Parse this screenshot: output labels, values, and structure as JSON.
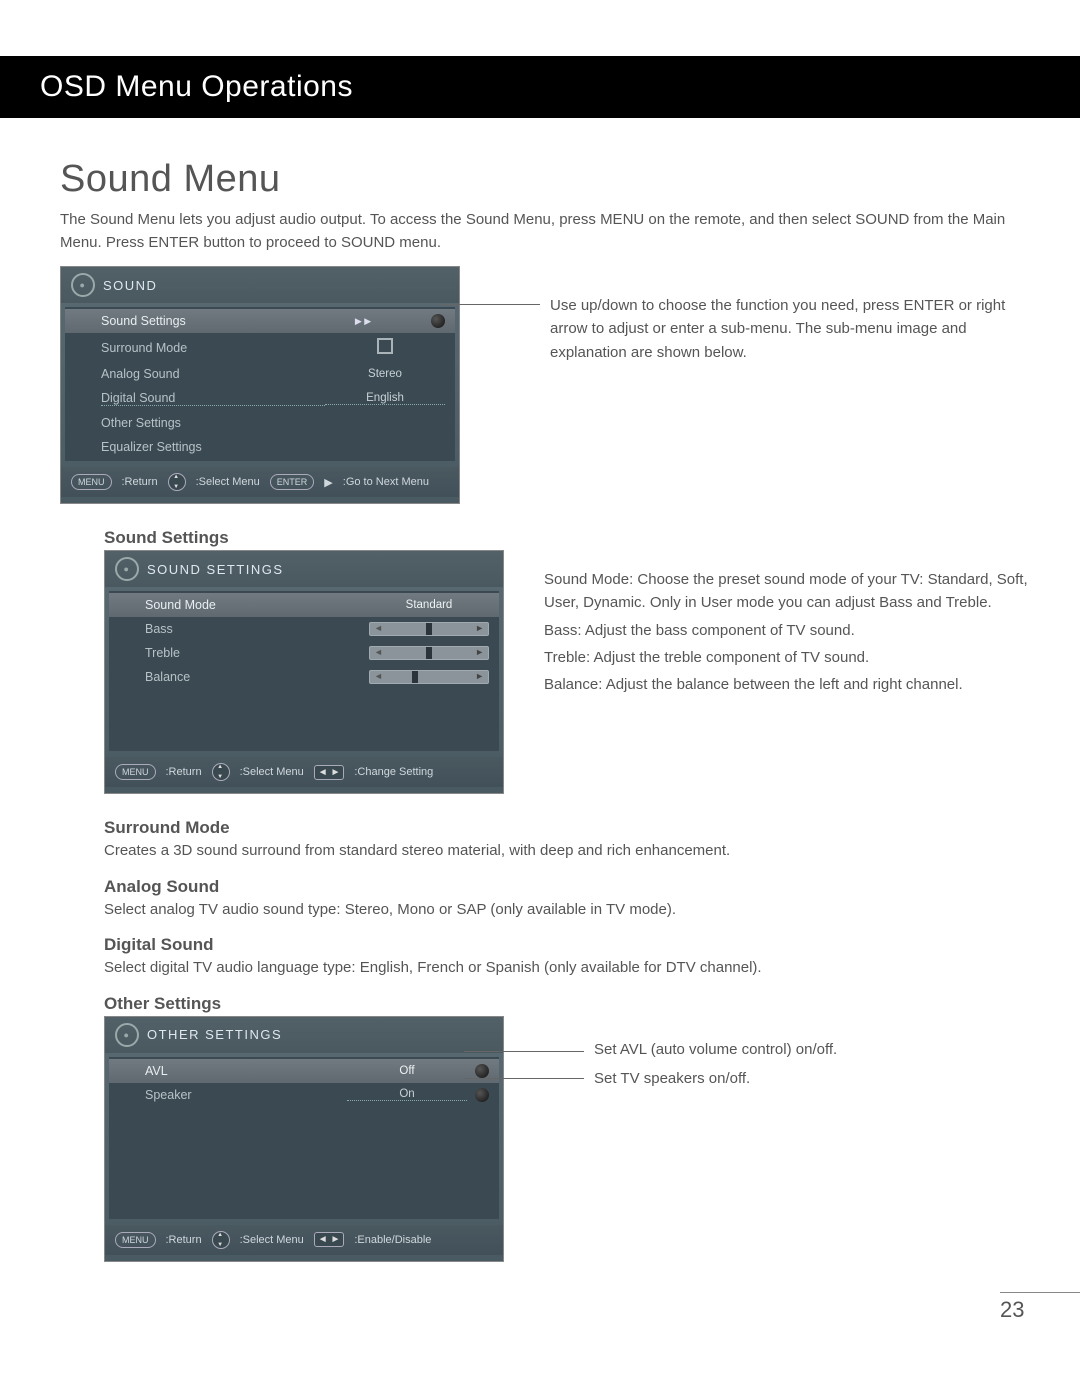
{
  "header": {
    "title": "OSD Menu Operations"
  },
  "section_title": "Sound Menu",
  "intro": "The Sound Menu lets you adjust audio output. To access the Sound Menu, press MENU on the remote, and then select SOUND from the Main Menu. Press ENTER button to proceed to SOUND menu.",
  "osd_sound": {
    "title": "SOUND",
    "items": [
      {
        "label": "Sound Settings",
        "value": "▶  ▶",
        "selected": true,
        "has_dot": true
      },
      {
        "label": "Surround Mode",
        "value": "",
        "is_square": true
      },
      {
        "label": "Analog Sound",
        "value": "Stereo"
      },
      {
        "label": "Digital Sound",
        "value": "English",
        "dotted": true
      },
      {
        "label": "Other Settings",
        "value": ""
      },
      {
        "label": "Equalizer Settings",
        "value": ""
      }
    ],
    "footer": {
      "menu_badge": "MENU",
      "return_label": ":Return",
      "select_label": ":Select Menu",
      "enter_badge": "ENTER",
      "next_label": ":Go to Next Menu"
    }
  },
  "callout1": "Use up/down to choose the function you need, press ENTER or right arrow to adjust or enter a sub-menu. The sub-menu image and explanation are shown below.",
  "sound_settings": {
    "heading": "Sound Settings",
    "osd": {
      "title": "SOUND SETTINGS",
      "items": [
        {
          "label": "Sound Mode",
          "value": "Standard",
          "selected": true
        },
        {
          "label": "Bass",
          "slider": true
        },
        {
          "label": "Treble",
          "slider": true
        },
        {
          "label": "Balance",
          "slider": true,
          "slider_pos": "left"
        }
      ],
      "footer": {
        "menu_badge": "MENU",
        "return_label": ":Return",
        "select_label": ":Select Menu",
        "change_label": ":Change Setting"
      }
    },
    "text": [
      "Sound Mode: Choose the preset sound mode of your TV: Standard, Soft, User, Dynamic. Only in User mode you can adjust Bass and Treble.",
      "Bass: Adjust the bass component of TV sound.",
      "Treble: Adjust the treble component of TV sound.",
      "Balance: Adjust the balance between the left and right channel."
    ]
  },
  "surround": {
    "heading": "Surround Mode",
    "text": "Creates a 3D sound surround from standard stereo material, with deep and rich enhancement."
  },
  "analog": {
    "heading": "Analog Sound",
    "text": "Select analog TV audio sound type: Stereo, Mono or SAP (only available in TV mode)."
  },
  "digital": {
    "heading": "Digital Sound",
    "text": "Select digital TV audio language type: English, French or Spanish (only available for DTV channel)."
  },
  "other": {
    "heading": "Other Settings",
    "osd": {
      "title": "OTHER SETTINGS",
      "items": [
        {
          "label": "AVL",
          "value": "Off",
          "selected": true,
          "has_dot": true
        },
        {
          "label": "Speaker",
          "value": "On",
          "has_dot": true,
          "dotted": true
        }
      ],
      "footer": {
        "menu_badge": "MENU",
        "return_label": ":Return",
        "select_label": ":Select Menu",
        "enable_label": ":Enable/Disable"
      }
    },
    "callouts": [
      "Set AVL (auto volume control) on/off.",
      "Set TV speakers on/off."
    ]
  },
  "page_number": "23"
}
